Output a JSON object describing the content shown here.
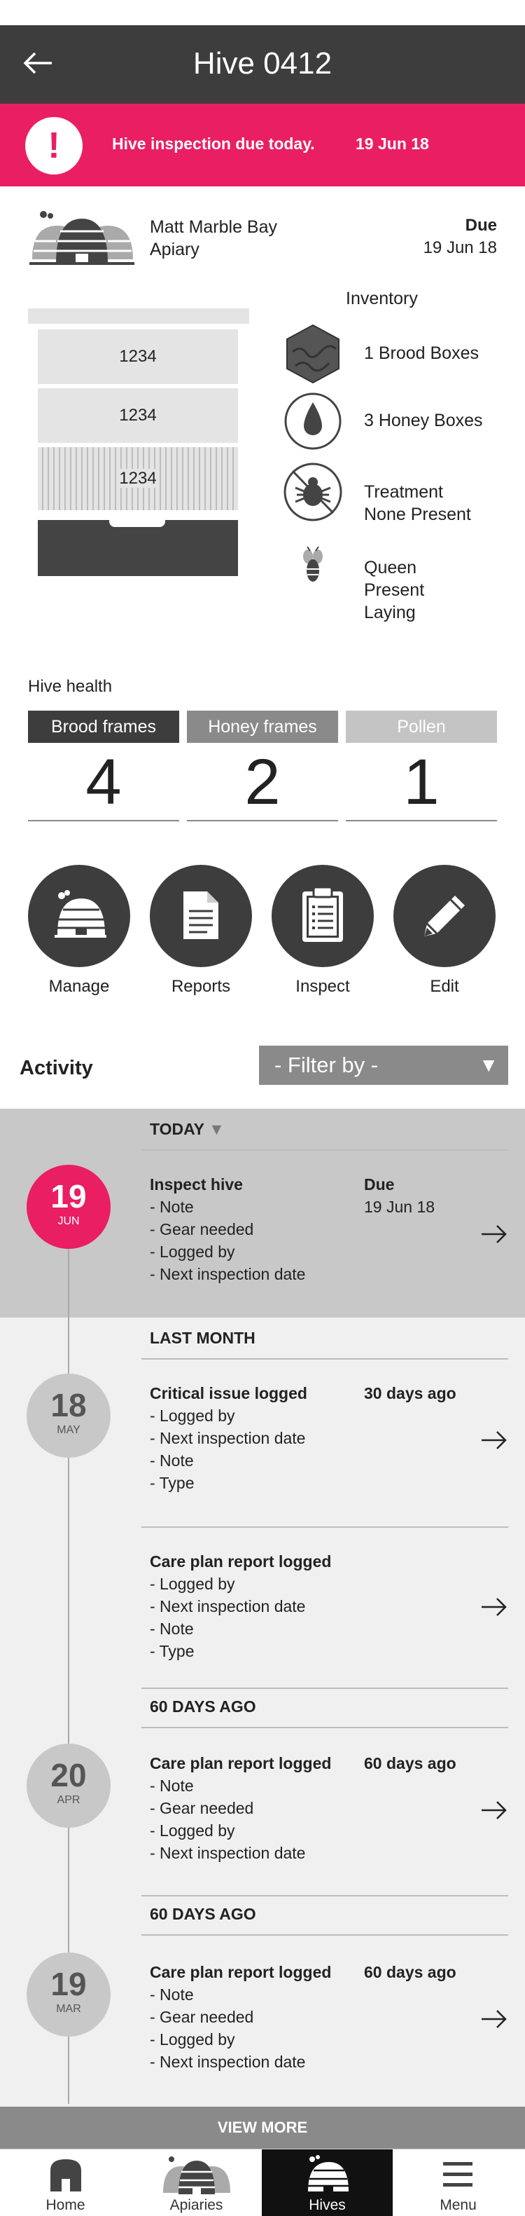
{
  "header": {
    "title": "Hive 0412"
  },
  "alert": {
    "text": "Hive inspection due today.",
    "date": "19 Jun 18",
    "icon": "!"
  },
  "apiary": {
    "name": "Matt Marble Bay Apiary",
    "due_label": "Due",
    "due_date": "19 Jun 18"
  },
  "hive_boxes": [
    "1234",
    "1234",
    "1234"
  ],
  "inventory": {
    "title": "Inventory",
    "items": [
      {
        "icon": "brood-box-icon",
        "label": "1 Brood Boxes"
      },
      {
        "icon": "honey-drop-icon",
        "label": "3 Honey Boxes"
      },
      {
        "icon": "no-mite-icon",
        "label": "Treatment\nNone Present"
      },
      {
        "icon": "queen-bee-icon",
        "label": "Queen\nPresent\nLaying"
      }
    ]
  },
  "health": {
    "title": "Hive health",
    "cols": [
      {
        "label": "Brood frames",
        "value": "4",
        "color": "#3d3d3d"
      },
      {
        "label": "Honey frames",
        "value": "2",
        "color": "#8a8a8a"
      },
      {
        "label": "Pollen",
        "value": "1",
        "color": "#c4c4c4"
      }
    ]
  },
  "actions": [
    {
      "label": "Manage",
      "icon": "hive-icon"
    },
    {
      "label": "Reports",
      "icon": "document-icon"
    },
    {
      "label": "Inspect",
      "icon": "clipboard-icon"
    },
    {
      "label": "Edit",
      "icon": "pencil-icon"
    }
  ],
  "activity": {
    "title": "Activity",
    "filter": "- Filter by  -",
    "sections": [
      {
        "heading": "TODAY"
      },
      {
        "heading": "LAST MONTH"
      },
      {
        "heading": "60 DAYS AGO"
      },
      {
        "heading": "60 DAYS AGO"
      }
    ],
    "dates": [
      {
        "day": "19",
        "month": "JUN",
        "accent": "#ea1e63"
      },
      {
        "day": "18",
        "month": "MAY"
      },
      {
        "day": "20",
        "month": "APR"
      },
      {
        "day": "19",
        "month": "MAR"
      }
    ],
    "items": [
      {
        "title": "Inspect hive",
        "right": "Due",
        "right2": "19 Jun 18",
        "lines": [
          "- Note",
          "- Gear needed",
          "- Logged by",
          "- Next inspection date"
        ]
      },
      {
        "title": "Critical issue logged",
        "right": "30 days ago",
        "lines": [
          "- Logged by",
          "- Next inspection date",
          "- Note",
          "- Type"
        ]
      },
      {
        "title": "Care plan report logged",
        "right": "",
        "lines": [
          "- Logged by",
          "- Next inspection date",
          "- Note",
          "- Type"
        ]
      },
      {
        "title": "Care plan report logged",
        "right": "60 days ago",
        "lines": [
          "- Note",
          "- Gear needed",
          "- Logged by",
          "- Next inspection date"
        ]
      },
      {
        "title": "Care plan report logged",
        "right": "60 days ago",
        "lines": [
          "- Note",
          "- Gear needed",
          "- Logged by",
          "- Next inspection date"
        ]
      }
    ],
    "view_more": "VIEW MORE"
  },
  "tabs": [
    {
      "label": "Home",
      "icon": "home-icon"
    },
    {
      "label": "Apiaries",
      "icon": "apiaries-icon"
    },
    {
      "label": "Hives",
      "icon": "hive-icon",
      "active": true
    },
    {
      "label": "Menu",
      "icon": "menu-icon"
    }
  ]
}
